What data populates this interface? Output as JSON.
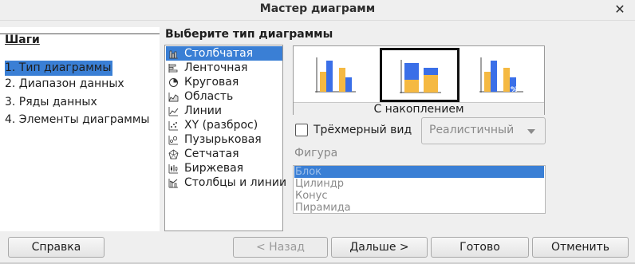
{
  "window": {
    "title": "Мастер диаграмм",
    "close_icon": "close-icon"
  },
  "steps": {
    "title": "Шаги",
    "items": [
      {
        "label": "1. Тип диаграммы",
        "active": true
      },
      {
        "label": "2. Диапазон данных",
        "active": false
      },
      {
        "label": "3. Ряды данных",
        "active": false
      },
      {
        "label": "4. Элементы диаграммы",
        "active": false
      }
    ]
  },
  "chart_type": {
    "heading": "Выберите тип диаграммы",
    "items": [
      {
        "label": "Столбчатая",
        "icon": "column-chart-icon",
        "selected": true
      },
      {
        "label": "Ленточная",
        "icon": "bar-chart-icon",
        "selected": false
      },
      {
        "label": "Круговая",
        "icon": "pie-chart-icon",
        "selected": false
      },
      {
        "label": "Область",
        "icon": "area-chart-icon",
        "selected": false
      },
      {
        "label": "Линии",
        "icon": "line-chart-icon",
        "selected": false
      },
      {
        "label": "XY (разброс)",
        "icon": "scatter-chart-icon",
        "selected": false
      },
      {
        "label": "Пузырьковая",
        "icon": "bubble-chart-icon",
        "selected": false
      },
      {
        "label": "Сетчатая",
        "icon": "net-chart-icon",
        "selected": false
      },
      {
        "label": "Биржевая",
        "icon": "stock-chart-icon",
        "selected": false
      },
      {
        "label": "Столбцы и линии",
        "icon": "column-line-chart-icon",
        "selected": false
      }
    ]
  },
  "variants": {
    "selected_label": "С накоплением",
    "items": [
      {
        "name": "normal",
        "icon": "column-normal-icon"
      },
      {
        "name": "stacked",
        "icon": "column-stacked-icon"
      },
      {
        "name": "percent",
        "icon": "column-percent-icon"
      }
    ]
  },
  "options": {
    "three_d_label": "Трёхмерный вид",
    "three_d_checked": false,
    "style_value": "Реалистичный",
    "shape_label": "Фигура",
    "shapes": [
      {
        "label": "Блок",
        "selected": true
      },
      {
        "label": "Цилиндр",
        "selected": false
      },
      {
        "label": "Конус",
        "selected": false
      },
      {
        "label": "Пирамида",
        "selected": false
      }
    ]
  },
  "buttons": {
    "help": "Справка",
    "back": "< Назад",
    "next": "Дальше >",
    "finish": "Готово",
    "cancel": "Отменить"
  },
  "colors": {
    "accent": "#3a7fd5",
    "bar_blue": "#3a6fe8",
    "bar_orange": "#f5b942"
  }
}
